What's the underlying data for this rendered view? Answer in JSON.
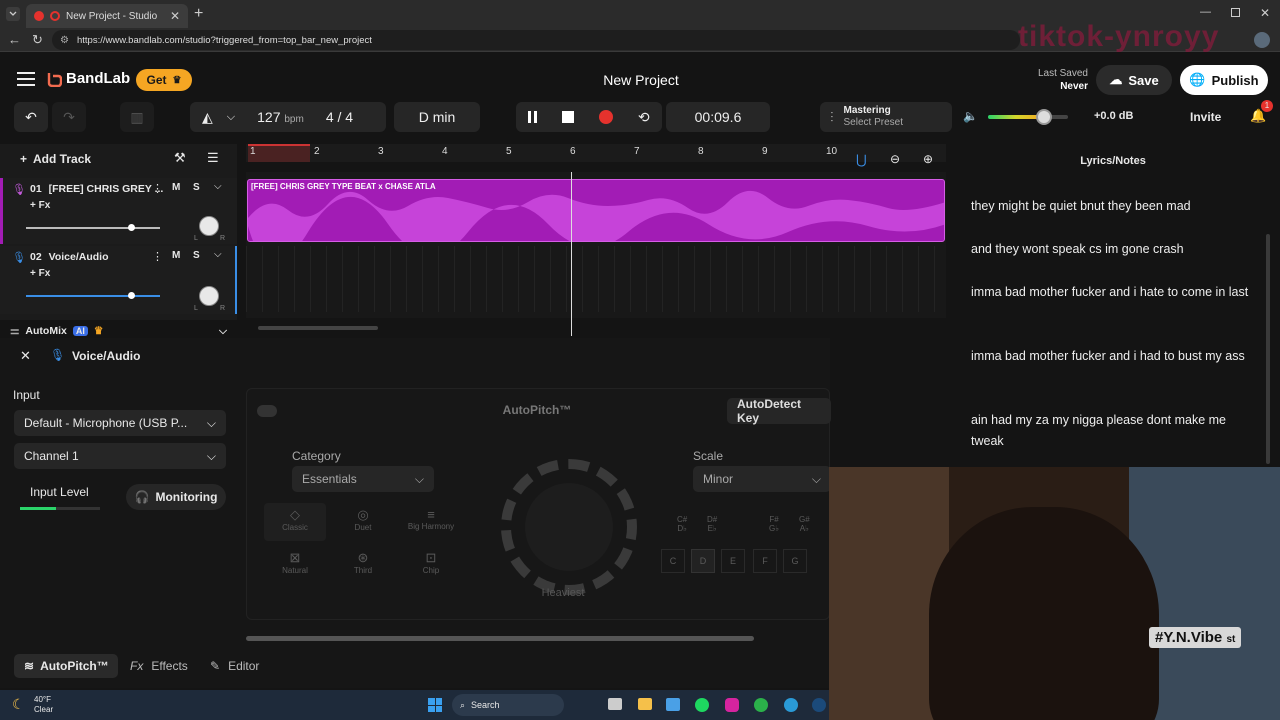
{
  "browser": {
    "tab_title": "New Project - Studio",
    "url": "https://www.bandlab.com/studio?triggered_from=top_bar_new_project"
  },
  "header": {
    "brand": "BandLab",
    "get_label": "Get",
    "project_title": "New Project",
    "last_saved_label": "Last Saved",
    "last_saved_value": "Never",
    "save_label": "Save",
    "publish_label": "Publish"
  },
  "transport": {
    "tempo": "127",
    "tempo_unit": "bpm",
    "time_signature": "4 / 4",
    "key": "D min",
    "time": "00:09.6",
    "mastering_label": "Mastering",
    "mastering_preset": "Select Preset",
    "volume_db": "+0.0 dB",
    "volume_level": 0.8,
    "invite_label": "Invite",
    "notification_count": "1"
  },
  "tracks": {
    "add_track_label": "Add Track",
    "items": [
      {
        "number": "01",
        "name": "[FREE] CHRIS GREY ...",
        "fx": "+ Fx",
        "mute": "M",
        "solo": "S",
        "pan_r": "R",
        "pan_l": "L",
        "volume": 0.78
      },
      {
        "number": "02",
        "name": "Voice/Audio",
        "fx": "+ Fx",
        "mute": "M",
        "solo": "S",
        "pan_r": "R",
        "pan_l": "L",
        "volume": 0.78
      }
    ],
    "clip_name": "[FREE] CHRIS GREY TYPE BEAT x CHASE ATLA",
    "ruler": [
      "1",
      "2",
      "3",
      "4",
      "5",
      "6",
      "7",
      "8",
      "9",
      "10"
    ],
    "automix_label": "AutoMix",
    "ai_badge": "AI"
  },
  "lyrics": {
    "title": "Lyrics/Notes",
    "lines": [
      "they might be quiet bnut they been mad",
      "and they wont speak cs im gone crash",
      "imma bad mother fucker and i hate to come in last",
      "imma bad mother fucker and i had to bust my ass",
      "ain had my za my nigga please dont make me tweak"
    ]
  },
  "panel": {
    "track_name": "Voice/Audio",
    "input_label": "Input",
    "input_device": "Default - Microphone (USB P...",
    "channel": "Channel 1",
    "input_level_label": "Input Level",
    "monitoring_label": "Monitoring",
    "autopitch_title": "AutoPitch™",
    "autodetect_label": "AutoDetect Key",
    "category_label": "Category",
    "category_value": "Essentials",
    "scale_label": "Scale",
    "scale_value": "Minor",
    "knob_label": "Heaviest",
    "effects": [
      "Classic",
      "Duet",
      "Big Harmony",
      "Natural",
      "Third",
      "Chip"
    ],
    "sharp_keys": [
      "C#\nD♭",
      "D#\nE♭",
      "F#\nG♭",
      "G#\nA♭"
    ],
    "keys": [
      "C",
      "D",
      "E",
      "F",
      "G"
    ],
    "tabs": [
      "AutoPitch™",
      "Effects",
      "Editor"
    ],
    "tab_fx": "Fx"
  },
  "overlay": {
    "watermark": "tiktok-ynroyy",
    "sticker": "#Y.N.Vibe",
    "sticker_suffix": "st"
  },
  "taskbar": {
    "weather_temp": "40°F",
    "weather_desc": "Clear",
    "search_label": "Search"
  },
  "colors": {
    "accent_orange": "#f26b4f",
    "clip_purple": "#a21cb5",
    "record_red": "#e5322d",
    "get_yellow": "#f5a623"
  }
}
